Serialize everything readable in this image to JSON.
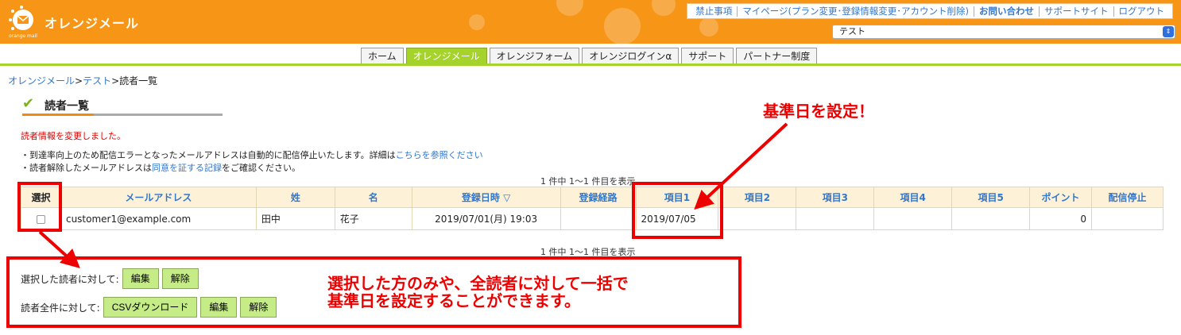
{
  "app": {
    "logo_text": "オレンジメール",
    "logo_sub": "orange mail"
  },
  "toplinks": [
    "禁止事項",
    "マイページ(プラン変更･登録情報変更･アカウント削除)",
    "お問い合わせ",
    "サポートサイト",
    "ログアウト"
  ],
  "account_select": {
    "value": "テスト"
  },
  "nav": {
    "tabs": [
      {
        "label": "ホーム",
        "active": false
      },
      {
        "label": "オレンジメール",
        "active": true
      },
      {
        "label": "オレンジフォーム",
        "active": false
      },
      {
        "label": "オレンジログインα",
        "active": false
      },
      {
        "label": "サポート",
        "active": false
      },
      {
        "label": "パートナー制度",
        "active": false
      }
    ]
  },
  "breadcrumb": {
    "item1": "オレンジメール",
    "sep": ">",
    "item2": "テスト",
    "current": "読者一覧"
  },
  "page_title": "読者一覧",
  "status_msg": "読者情報を変更しました。",
  "notes": {
    "line1_prefix": "・到達率向上のため配信エラーとなったメールアドレスは自動的に配信停止いたします。詳細は",
    "line1_link": "こちらを参照ください",
    "line2_prefix": "・読者解除したメールアドレスは",
    "line2_link": "同意を証する記録",
    "line2_suffix": "をご確認ください。"
  },
  "pager_text": "1 件中 1〜1 件目を表示",
  "table": {
    "headers": {
      "select": "選択",
      "email": "メールアドレス",
      "last_name": "姓",
      "first_name": "名",
      "registered_at": "登録日時 ▽",
      "route": "登録経路",
      "item1": "項目1",
      "item2": "項目2",
      "item3": "項目3",
      "item4": "項目4",
      "item5": "項目5",
      "points": "ポイント",
      "stopped": "配信停止"
    },
    "rows": [
      {
        "email": "customer1@example.com",
        "last_name": "田中",
        "first_name": "花子",
        "registered_at": "2019/07/01(月) 19:03",
        "route": "",
        "item1": "2019/07/05",
        "item2": "",
        "item3": "",
        "item4": "",
        "item5": "",
        "points": "0",
        "stopped": ""
      }
    ]
  },
  "actions": {
    "selected_label": "選択した読者に対して:",
    "all_label": "読者全件に対して:",
    "edit": "編集",
    "remove": "解除",
    "csv": "CSVダウンロード"
  },
  "annotations": {
    "top": "基準日を設定！",
    "bottom_line1": "選択した方のみや、全読者に対して一括で",
    "bottom_line2": "基準日を設定することができます。",
    "color": "#ee0000"
  },
  "colors": {
    "header_orange": "#f79516",
    "nav_green": "#a6d22c",
    "link_blue": "#3377cc",
    "table_header_bg": "#fdf2d8",
    "button_green": "#c5ec86"
  }
}
